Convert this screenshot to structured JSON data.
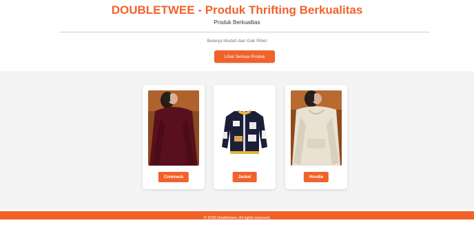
{
  "header": {
    "title": "DOUBLETWEE - Produk Thrifting Berkualitas",
    "subtitle": "Produk Berkualitas"
  },
  "hero": {
    "tagline": "Belanja Mudah dan Gak Ribet",
    "cta_label": "Lihat Semua Produk"
  },
  "products": [
    {
      "label": "Crewneck"
    },
    {
      "label": "Jacket"
    },
    {
      "label": "Hoodie"
    }
  ],
  "footer": {
    "copyright": "© 2025 Doubletwee. All rights reserved."
  },
  "colors": {
    "accent": "#f0622a",
    "section_bg": "#f4f4f4"
  }
}
